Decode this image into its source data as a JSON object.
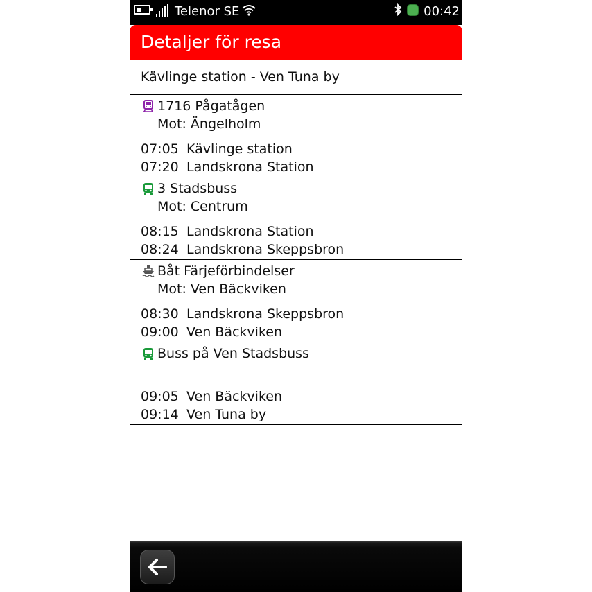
{
  "statusbar": {
    "operator": "Telenor SE",
    "time": "00:42",
    "icons": [
      "battery-icon",
      "signal-icon",
      "wifi-icon",
      "bluetooth-icon",
      "notification-icon"
    ]
  },
  "header": {
    "title": "Detaljer för resa"
  },
  "route": "Kävlinge station - Ven Tuna by",
  "legs": [
    {
      "mode": "train",
      "icon": "train-icon",
      "icon_color": "#8e24aa",
      "line": "1716 Pågatågen",
      "direction": "Mot: Ängelholm",
      "stops": [
        {
          "time": "07:05",
          "name": "Kävlinge station"
        },
        {
          "time": "07:20",
          "name": "Landskrona Station"
        }
      ]
    },
    {
      "mode": "bus",
      "icon": "bus-icon",
      "icon_color": "#1a9a3a",
      "line": "3 Stadsbuss",
      "direction": "Mot: Centrum",
      "stops": [
        {
          "time": "08:15",
          "name": "Landskrona Station"
        },
        {
          "time": "08:24",
          "name": "Landskrona Skeppsbron"
        }
      ]
    },
    {
      "mode": "boat",
      "icon": "ferry-icon",
      "icon_color": "#555555",
      "line": "Båt Färjeförbindelser",
      "direction": "Mot: Ven Bäckviken",
      "stops": [
        {
          "time": "08:30",
          "name": "Landskrona Skeppsbron"
        },
        {
          "time": "09:00",
          "name": "Ven Bäckviken"
        }
      ]
    },
    {
      "mode": "bus",
      "icon": "bus-icon",
      "icon_color": "#1a9a3a",
      "line": "Buss på Ven Stadsbuss",
      "direction": "",
      "stops": [
        {
          "time": "09:05",
          "name": "Ven Bäckviken"
        },
        {
          "time": "09:14",
          "name": "Ven Tuna by"
        }
      ]
    }
  ],
  "toolbar": {
    "back_icon": "back-arrow-icon"
  },
  "colors": {
    "header": "#ff0000",
    "statusbar": "#000000",
    "toolbar": "#000000"
  }
}
